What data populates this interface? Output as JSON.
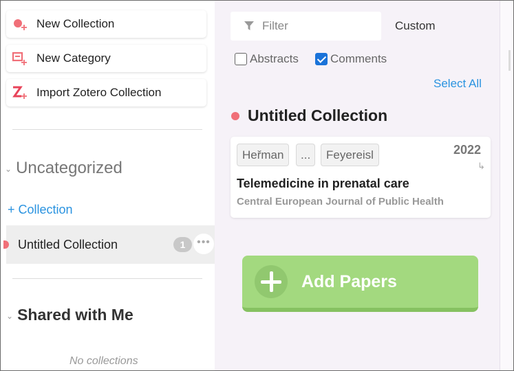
{
  "sidebar": {
    "actions": {
      "new_collection": "New Collection",
      "new_category": "New Category",
      "import_zotero": "Import Zotero Collection"
    },
    "uncategorized": {
      "heading": "Uncategorized",
      "add_collection": "+ Collection"
    },
    "collections": [
      {
        "name": "Untitled Collection",
        "count": "1"
      }
    ],
    "shared": {
      "heading": "Shared with Me",
      "empty": "No collections"
    }
  },
  "main": {
    "filter": {
      "placeholder": "Filter"
    },
    "custom": "Custom",
    "toggles": {
      "abstracts": {
        "label": "Abstracts",
        "checked": false
      },
      "comments": {
        "label": "Comments",
        "checked": true
      }
    },
    "select_all": "Select All",
    "collection_title": "Untitled Collection",
    "papers": [
      {
        "authors": [
          "Heřman",
          "...",
          "Feyereisl"
        ],
        "year": "2022",
        "title": "Telemedicine in prenatal care",
        "journal": "Central European Journal of Public Health"
      }
    ],
    "add_papers": "Add Papers"
  },
  "colors": {
    "accent_blue": "#2a93e0",
    "collection_dot": "#f06f78",
    "add_button": "#a3d97f"
  }
}
